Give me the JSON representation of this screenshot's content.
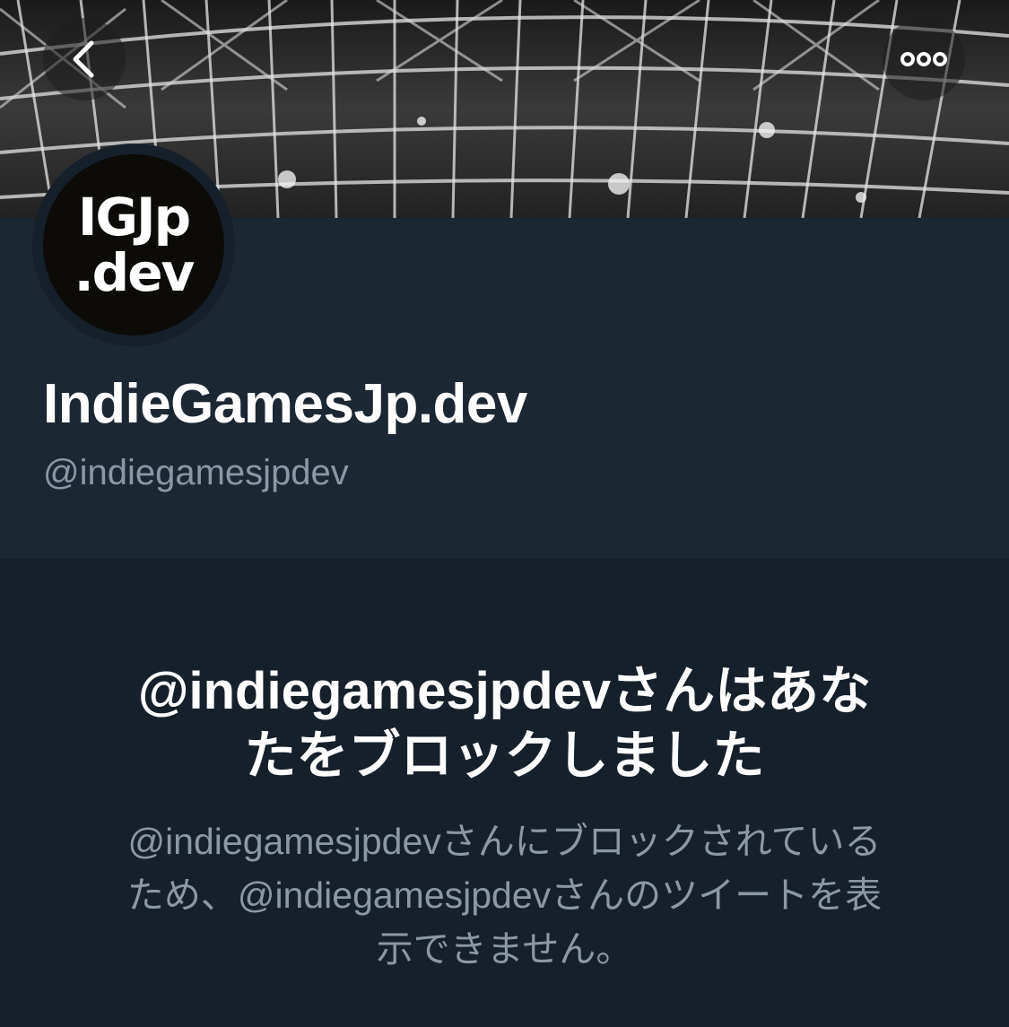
{
  "profile": {
    "avatar_line1": "IGJp",
    "avatar_line2": ".dev",
    "display_name": "IndieGamesJp.dev",
    "handle": "@indiegamesjpdev"
  },
  "navigation": {
    "back_icon": "chevron-left-icon",
    "more_icon": "more-options-icon"
  },
  "blocked_notice": {
    "title_line1": "@indiegamesjpdevさんはあな",
    "title_line2": "たをブロックしました",
    "description_line1": "@indiegamesjpdevさんにブロックされている",
    "description_line2": "ため、@indiegamesjpdevさんのツイートを表",
    "description_line3": "示できません。"
  },
  "colors": {
    "background": "#15202b",
    "profile_background": "#1b2733",
    "text_primary": "#ffffff",
    "text_secondary": "#8b98a5"
  }
}
